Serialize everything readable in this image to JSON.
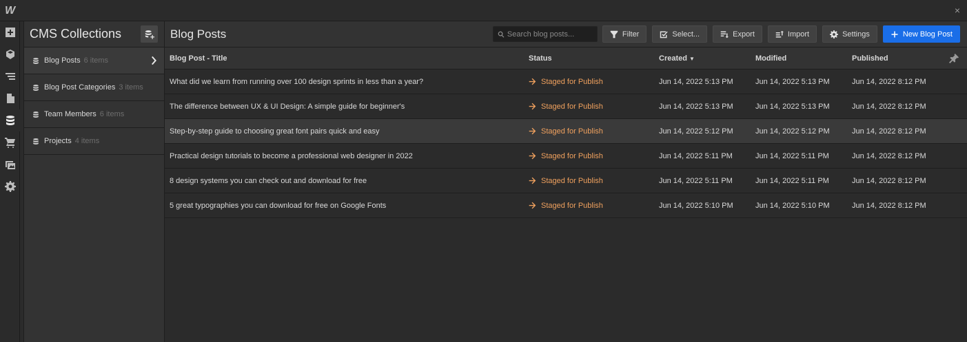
{
  "app": {
    "logo": "W",
    "close": "×"
  },
  "rail": [
    {
      "name": "add-panel-icon"
    },
    {
      "name": "components-icon"
    },
    {
      "name": "navigator-icon"
    },
    {
      "name": "pages-icon"
    },
    {
      "name": "cms-icon",
      "active": true
    },
    {
      "name": "ecommerce-icon"
    },
    {
      "name": "assets-icon"
    },
    {
      "name": "settings-icon"
    }
  ],
  "collections": {
    "title": "CMS Collections",
    "items": [
      {
        "name": "Blog Posts",
        "count": "6 items",
        "active": true
      },
      {
        "name": "Blog Post Categories",
        "count": "3 items"
      },
      {
        "name": "Team Members",
        "count": "6 items"
      },
      {
        "name": "Projects",
        "count": "4 items"
      }
    ]
  },
  "main": {
    "title": "Blog Posts",
    "search_placeholder": "Search blog posts...",
    "buttons": {
      "filter": "Filter",
      "select": "Select...",
      "export": "Export",
      "import": "Import",
      "settings": "Settings",
      "new": "New Blog Post"
    },
    "columns": {
      "title": "Blog Post - Title",
      "status": "Status",
      "created": "Created",
      "modified": "Modified",
      "published": "Published"
    },
    "rows": [
      {
        "title": "What did we learn from running over 100 design sprints in less than a year?",
        "status": "Staged for Publish",
        "created": "Jun 14, 2022 5:13 PM",
        "modified": "Jun 14, 2022 5:13 PM",
        "published": "Jun 14, 2022 8:12 PM"
      },
      {
        "title": "The difference between UX & UI Design: A simple guide for beginner's",
        "status": "Staged for Publish",
        "created": "Jun 14, 2022 5:13 PM",
        "modified": "Jun 14, 2022 5:13 PM",
        "published": "Jun 14, 2022 8:12 PM"
      },
      {
        "title": "Step-by-step guide to choosing great font pairs quick and easy",
        "status": "Staged for Publish",
        "created": "Jun 14, 2022 5:12 PM",
        "modified": "Jun 14, 2022 5:12 PM",
        "published": "Jun 14, 2022 8:12 PM"
      },
      {
        "title": "Practical design tutorials to become a professional web designer in 2022",
        "status": "Staged for Publish",
        "created": "Jun 14, 2022 5:11 PM",
        "modified": "Jun 14, 2022 5:11 PM",
        "published": "Jun 14, 2022 8:12 PM"
      },
      {
        "title": "8 design systems you can check out and download for free",
        "status": "Staged for Publish",
        "created": "Jun 14, 2022 5:11 PM",
        "modified": "Jun 14, 2022 5:11 PM",
        "published": "Jun 14, 2022 8:12 PM"
      },
      {
        "title": "5 great typographies you can download for free on Google Fonts",
        "status": "Staged for Publish",
        "created": "Jun 14, 2022 5:10 PM",
        "modified": "Jun 14, 2022 5:10 PM",
        "published": "Jun 14, 2022 8:12 PM"
      }
    ]
  },
  "colors": {
    "accent": "#1a6ee8",
    "status": "#f0a15e",
    "background": "#2b2b2b",
    "panel": "#333333"
  }
}
